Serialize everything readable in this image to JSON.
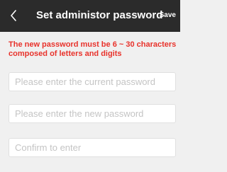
{
  "header": {
    "title": "Set administor password",
    "save_label": "Save",
    "back_icon": "chevron-left-icon"
  },
  "notice": {
    "text": "The new password must be 6 ~ 30 characters composed of letters and digits",
    "color": "#e8322b"
  },
  "form": {
    "current_password": {
      "placeholder": "Please enter the current password",
      "value": ""
    },
    "new_password": {
      "placeholder": "Please enter the new password",
      "value": ""
    },
    "confirm_password": {
      "placeholder": "Confirm to enter",
      "value": ""
    }
  },
  "colors": {
    "header_bg": "#2b2b2b",
    "page_bg": "#f0f0f0"
  }
}
